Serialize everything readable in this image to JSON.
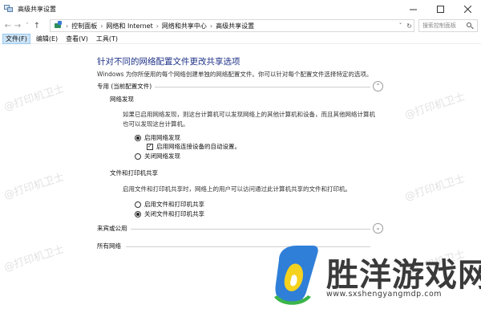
{
  "window": {
    "title": "高级共享设置",
    "controls": [
      "minimize-icon",
      "maximize-icon",
      "close-icon"
    ]
  },
  "address_bar": {
    "breadcrumbs": [
      "控制面板",
      "网络和 Internet",
      "网络和共享中心",
      "高级共享设置"
    ],
    "search_placeholder": "搜索控制面板"
  },
  "menu": {
    "items": [
      "文件(F)",
      "编辑(E)",
      "查看(V)",
      "工具(T)"
    ]
  },
  "main": {
    "heading": "针对不同的网络配置文件更改共享选项",
    "description": "Windows 为你所使用的每个网络创建单独的网络配置文件。你可以针对每个配置文件选择特定的选项。",
    "profiles": {
      "private_label": "专用 (当前配置文件)",
      "network_discovery": {
        "title": "网络发现",
        "description": "如果已启用网络发现，则这台计算机可以发现网络上的其他计算机和设备，而且其他网络计算机也可以发现这台计算机。",
        "on_label": "启用网络发现",
        "auto_setup_label": "启用网络连接设备的自动设置。",
        "off_label": "关闭网络发现"
      },
      "file_printer_sharing": {
        "title": "文件和打印机共享",
        "description": "启用文件和打印机共享时，网络上的用户可以访问通过此计算机共享的文件和打印机。",
        "on_label": "启用文件和打印机共享",
        "off_label": "关闭文件和打印机共享"
      },
      "guest_label": "来宾或公用",
      "all_networks_label": "所有网络"
    }
  },
  "state": {
    "network_discovery": "on",
    "auto_setup_checked": true,
    "file_printer_sharing": "off"
  },
  "watermark": "@打印机卫士",
  "brand": {
    "name": "胜洋游戏网",
    "url": "www.sxshengyangmdp.com"
  },
  "colors": {
    "heading": "#1e3287",
    "menu_active_bg": "#cce4f7"
  }
}
